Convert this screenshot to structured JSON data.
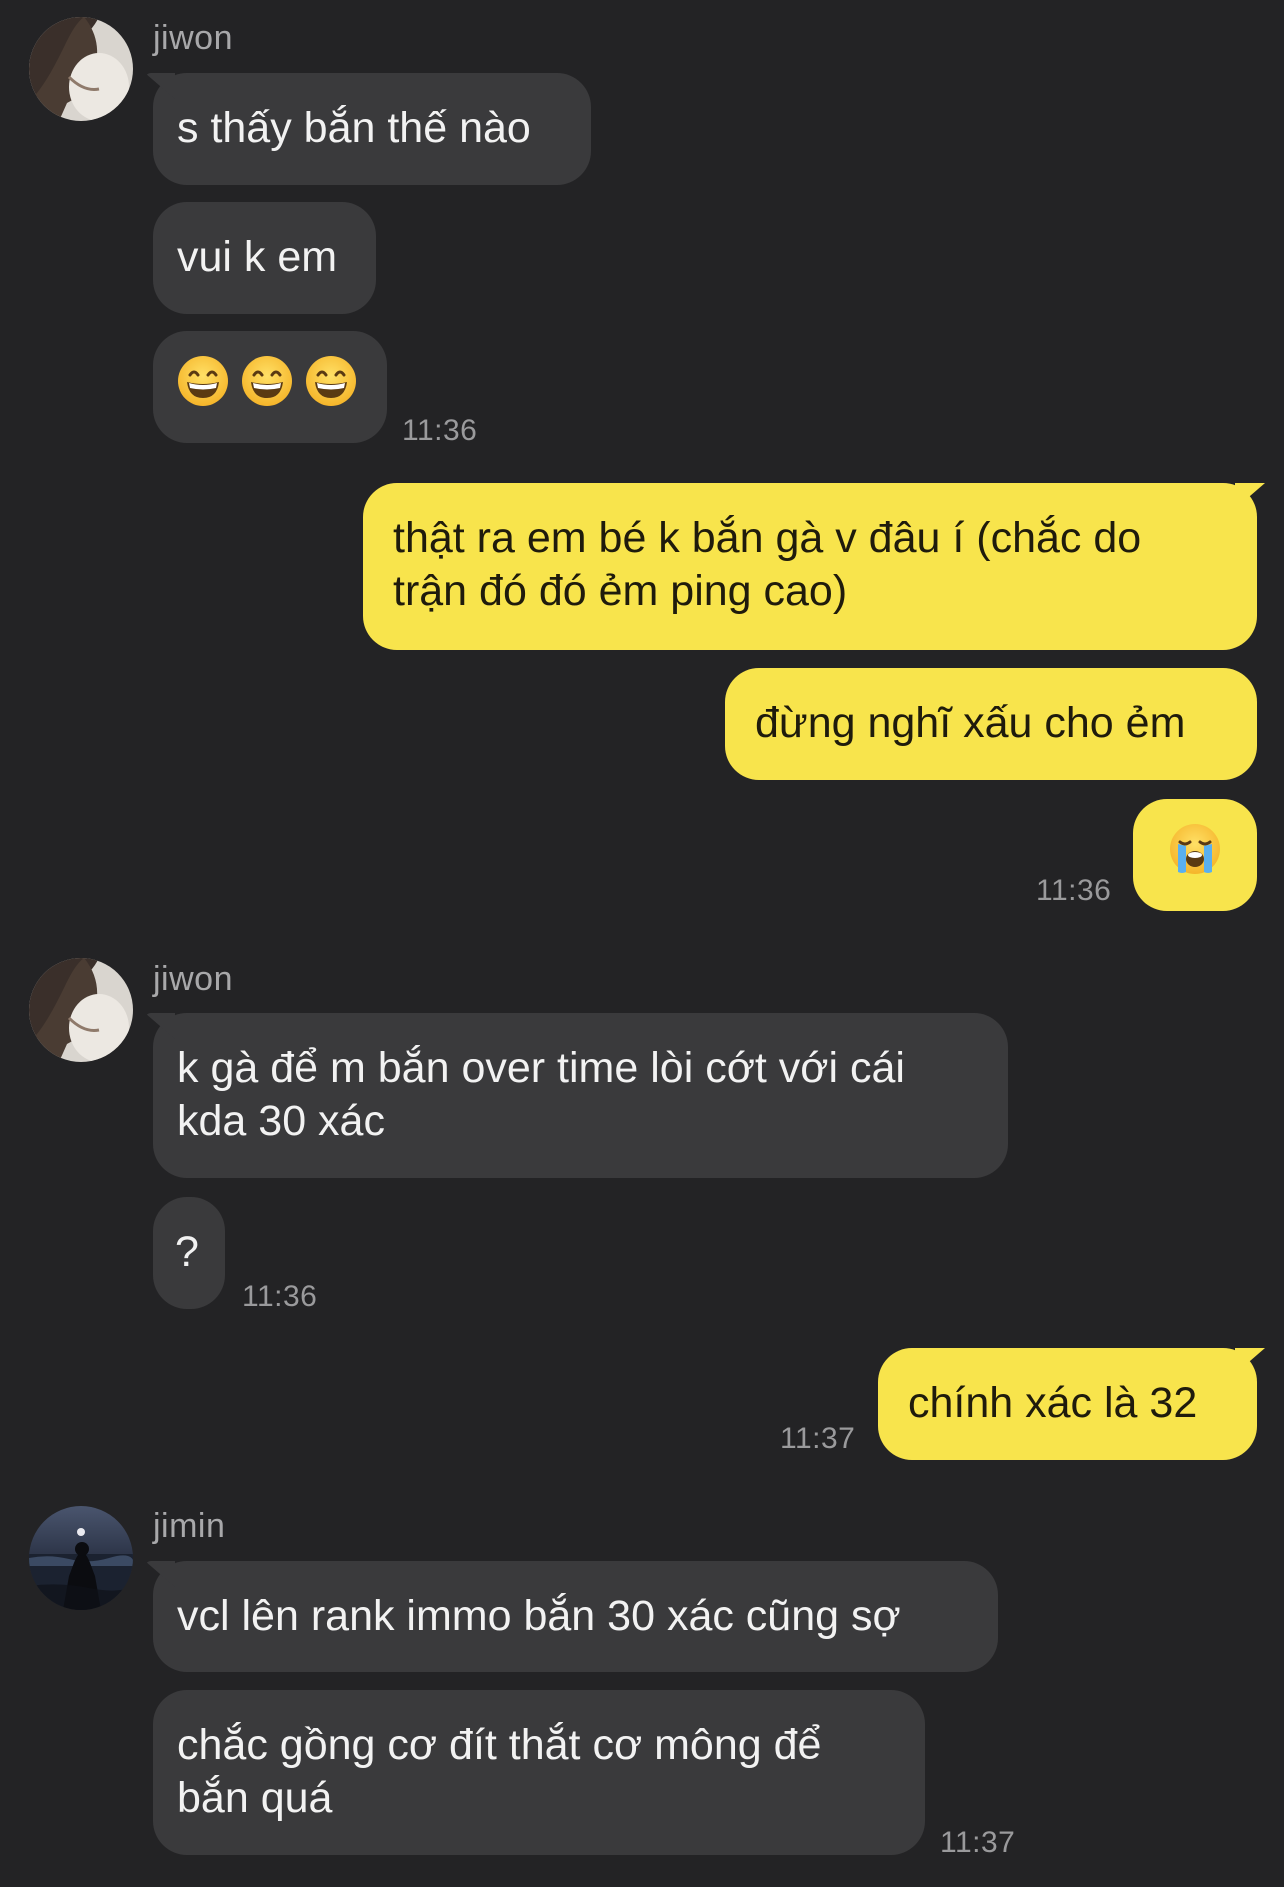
{
  "colors": {
    "background": "#232325",
    "incoming_bubble": "#3a3a3c",
    "outgoing_bubble": "#f8e44c",
    "timestamp": "#9a9a9c",
    "sender_name": "#a8a8aa"
  },
  "messages": {
    "group1": {
      "sender": "jiwon",
      "m1": "s thấy bắn thế nào",
      "m2": "vui k em",
      "m3_emojis": [
        "grinning-face-with-smiling-eyes",
        "grinning-face-with-smiling-eyes",
        "grinning-face-with-smiling-eyes"
      ],
      "time": "11:36"
    },
    "group2": {
      "sender": "me",
      "m1_line1": "thật ra em bé k bắn gà v đâu í (chắc do",
      "m1_line2": "trận đó đó ẻm ping cao)",
      "m2": "đừng nghĩ xấu cho ẻm",
      "m3_emoji": "loudly-crying-face",
      "time": "11:36"
    },
    "group3": {
      "sender": "jiwon",
      "m1_line1": "k gà để m bắn over time lòi cớt với cái",
      "m1_line2": "kda 30 xác",
      "m2": "?",
      "time": "11:36"
    },
    "group4": {
      "sender": "me",
      "m1": "chính xác là 32",
      "time": "11:37"
    },
    "group5": {
      "sender": "jimin",
      "m1": "vcl lên rank immo bắn 30 xác cũng sợ",
      "m2_line1": "chắc gồng cơ đít thắt cơ mông để",
      "m2_line2": "bắn quá",
      "time": "11:37"
    }
  }
}
